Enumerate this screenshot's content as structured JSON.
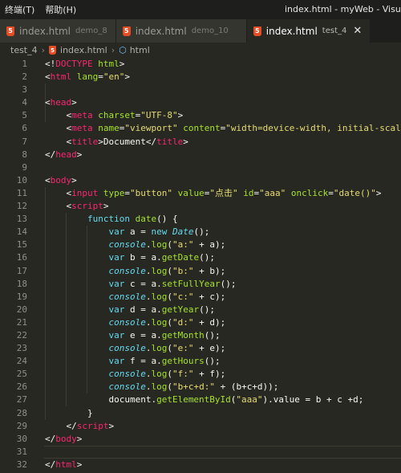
{
  "menubar": {
    "items": [
      {
        "label": "终端(T)"
      },
      {
        "label": "帮助(H)"
      }
    ],
    "window_title": "index.html - myWeb - Visual S"
  },
  "tabs": [
    {
      "icon": "html5-icon",
      "icon_glyph": "5",
      "name": "index.html",
      "dir": "demo_8",
      "active": false
    },
    {
      "icon": "html5-icon",
      "icon_glyph": "5",
      "name": "index.html",
      "dir": "demo_10",
      "active": false
    },
    {
      "icon": "html5-icon",
      "icon_glyph": "5",
      "name": "index.html",
      "dir": "test_4",
      "active": true,
      "close": "✕"
    }
  ],
  "breadcrumb": {
    "folder": "test_4",
    "sep": "›",
    "file": "index.html",
    "element": "html",
    "file_icon_glyph": "5",
    "element_icon_glyph": "⬡"
  },
  "colors": {
    "tag": "#f92672",
    "attr": "#a6e22e",
    "string": "#e6db74",
    "keyword": "#66d9ef",
    "text": "#f8f8f2",
    "func": "#a6e22e",
    "background": "#272822",
    "line_number": "#90908a"
  },
  "editor": {
    "current_line": 31,
    "lines": [
      {
        "n": "1",
        "tokens": [
          [
            "p",
            "<!"
          ],
          [
            "t",
            "DOCTYPE"
          ],
          [
            "p",
            " "
          ],
          [
            "a",
            "html"
          ],
          [
            "p",
            ">"
          ]
        ]
      },
      {
        "n": "2",
        "tokens": [
          [
            "p",
            "<"
          ],
          [
            "t",
            "html"
          ],
          [
            "p",
            " "
          ],
          [
            "a",
            "lang"
          ],
          [
            "p",
            "="
          ],
          [
            "s",
            "\"en\""
          ],
          [
            "p",
            ">"
          ]
        ]
      },
      {
        "n": "3",
        "tokens": []
      },
      {
        "n": "4",
        "tokens": [
          [
            "p",
            "<"
          ],
          [
            "t",
            "head"
          ],
          [
            "p",
            ">"
          ]
        ]
      },
      {
        "n": "5",
        "tokens": [
          [
            "p",
            "    <"
          ],
          [
            "t",
            "meta"
          ],
          [
            "p",
            " "
          ],
          [
            "a",
            "charset"
          ],
          [
            "p",
            "="
          ],
          [
            "s",
            "\"UTF-8\""
          ],
          [
            "p",
            ">"
          ]
        ]
      },
      {
        "n": "6",
        "tokens": [
          [
            "p",
            "    <"
          ],
          [
            "t",
            "meta"
          ],
          [
            "p",
            " "
          ],
          [
            "a",
            "name"
          ],
          [
            "p",
            "="
          ],
          [
            "s",
            "\"viewport\""
          ],
          [
            "p",
            " "
          ],
          [
            "a",
            "content"
          ],
          [
            "p",
            "="
          ],
          [
            "s",
            "\"width=device-width, initial-scale="
          ]
        ]
      },
      {
        "n": "7",
        "tokens": [
          [
            "p",
            "    <"
          ],
          [
            "t",
            "title"
          ],
          [
            "p",
            ">Document</"
          ],
          [
            "t",
            "title"
          ],
          [
            "p",
            ">"
          ]
        ]
      },
      {
        "n": "8",
        "tokens": [
          [
            "p",
            "</"
          ],
          [
            "t",
            "head"
          ],
          [
            "p",
            ">"
          ]
        ]
      },
      {
        "n": "9",
        "tokens": []
      },
      {
        "n": "10",
        "tokens": [
          [
            "p",
            "<"
          ],
          [
            "t",
            "body"
          ],
          [
            "p",
            ">"
          ]
        ]
      },
      {
        "n": "11",
        "tokens": [
          [
            "p",
            "    <"
          ],
          [
            "t",
            "input"
          ],
          [
            "p",
            " "
          ],
          [
            "a",
            "type"
          ],
          [
            "p",
            "="
          ],
          [
            "s",
            "\"button\""
          ],
          [
            "p",
            " "
          ],
          [
            "a",
            "value"
          ],
          [
            "p",
            "="
          ],
          [
            "s",
            "\"点击\""
          ],
          [
            "p",
            " "
          ],
          [
            "a",
            "id"
          ],
          [
            "p",
            "="
          ],
          [
            "s",
            "\"aaa\""
          ],
          [
            "p",
            " "
          ],
          [
            "a",
            "onclick"
          ],
          [
            "p",
            "="
          ],
          [
            "s",
            "\"date()\""
          ],
          [
            "p",
            ">"
          ]
        ]
      },
      {
        "n": "12",
        "tokens": [
          [
            "p",
            "    <"
          ],
          [
            "t",
            "script"
          ],
          [
            "p",
            ">"
          ]
        ]
      },
      {
        "n": "13",
        "tokens": [
          [
            "p",
            "        "
          ],
          [
            "k",
            "function"
          ],
          [
            "p",
            " "
          ],
          [
            "f",
            "date"
          ],
          [
            "p",
            "() {"
          ]
        ]
      },
      {
        "n": "14",
        "tokens": [
          [
            "p",
            "            "
          ],
          [
            "k",
            "var"
          ],
          [
            "p",
            " a = "
          ],
          [
            "k",
            "new"
          ],
          [
            "p",
            " "
          ],
          [
            "c",
            "Date"
          ],
          [
            "p",
            "();"
          ]
        ]
      },
      {
        "n": "15",
        "tokens": [
          [
            "p",
            "            "
          ],
          [
            "c",
            "console"
          ],
          [
            "p",
            "."
          ],
          [
            "f",
            "log"
          ],
          [
            "p",
            "("
          ],
          [
            "s",
            "\"a:\""
          ],
          [
            "p",
            " + a);"
          ]
        ]
      },
      {
        "n": "16",
        "tokens": [
          [
            "p",
            "            "
          ],
          [
            "k",
            "var"
          ],
          [
            "p",
            " b = a."
          ],
          [
            "f",
            "getDate"
          ],
          [
            "p",
            "();"
          ]
        ]
      },
      {
        "n": "17",
        "tokens": [
          [
            "p",
            "            "
          ],
          [
            "c",
            "console"
          ],
          [
            "p",
            "."
          ],
          [
            "f",
            "log"
          ],
          [
            "p",
            "("
          ],
          [
            "s",
            "\"b:\""
          ],
          [
            "p",
            " + b);"
          ]
        ]
      },
      {
        "n": "18",
        "tokens": [
          [
            "p",
            "            "
          ],
          [
            "k",
            "var"
          ],
          [
            "p",
            " c = a."
          ],
          [
            "f",
            "setFullYear"
          ],
          [
            "p",
            "();"
          ]
        ]
      },
      {
        "n": "19",
        "tokens": [
          [
            "p",
            "            "
          ],
          [
            "c",
            "console"
          ],
          [
            "p",
            "."
          ],
          [
            "f",
            "log"
          ],
          [
            "p",
            "("
          ],
          [
            "s",
            "\"c:\""
          ],
          [
            "p",
            " + c);"
          ]
        ]
      },
      {
        "n": "20",
        "tokens": [
          [
            "p",
            "            "
          ],
          [
            "k",
            "var"
          ],
          [
            "p",
            " d = a."
          ],
          [
            "f",
            "getYear"
          ],
          [
            "p",
            "();"
          ]
        ]
      },
      {
        "n": "21",
        "tokens": [
          [
            "p",
            "            "
          ],
          [
            "c",
            "console"
          ],
          [
            "p",
            "."
          ],
          [
            "f",
            "log"
          ],
          [
            "p",
            "("
          ],
          [
            "s",
            "\"d:\""
          ],
          [
            "p",
            " + d);"
          ]
        ]
      },
      {
        "n": "22",
        "tokens": [
          [
            "p",
            "            "
          ],
          [
            "k",
            "var"
          ],
          [
            "p",
            " e = a."
          ],
          [
            "f",
            "getMonth"
          ],
          [
            "p",
            "();"
          ]
        ]
      },
      {
        "n": "23",
        "tokens": [
          [
            "p",
            "            "
          ],
          [
            "c",
            "console"
          ],
          [
            "p",
            "."
          ],
          [
            "f",
            "log"
          ],
          [
            "p",
            "("
          ],
          [
            "s",
            "\"e:\""
          ],
          [
            "p",
            " + e);"
          ]
        ]
      },
      {
        "n": "24",
        "tokens": [
          [
            "p",
            "            "
          ],
          [
            "k",
            "var"
          ],
          [
            "p",
            " f = a."
          ],
          [
            "f",
            "getHours"
          ],
          [
            "p",
            "();"
          ]
        ]
      },
      {
        "n": "25",
        "tokens": [
          [
            "p",
            "            "
          ],
          [
            "c",
            "console"
          ],
          [
            "p",
            "."
          ],
          [
            "f",
            "log"
          ],
          [
            "p",
            "("
          ],
          [
            "s",
            "\"f:\""
          ],
          [
            "p",
            " + f);"
          ]
        ]
      },
      {
        "n": "26",
        "tokens": [
          [
            "p",
            "            "
          ],
          [
            "c",
            "console"
          ],
          [
            "p",
            "."
          ],
          [
            "f",
            "log"
          ],
          [
            "p",
            "("
          ],
          [
            "s",
            "\"b+c+d:\""
          ],
          [
            "p",
            " + (b+c+d));"
          ]
        ]
      },
      {
        "n": "27",
        "tokens": [
          [
            "p",
            "            document."
          ],
          [
            "f",
            "getElementById"
          ],
          [
            "p",
            "("
          ],
          [
            "s",
            "\"aaa\""
          ],
          [
            "p",
            ").value = b + c +d;"
          ]
        ]
      },
      {
        "n": "28",
        "tokens": [
          [
            "p",
            "        }"
          ]
        ]
      },
      {
        "n": "29",
        "tokens": [
          [
            "p",
            "    </"
          ],
          [
            "t",
            "script"
          ],
          [
            "p",
            ">"
          ]
        ]
      },
      {
        "n": "30",
        "tokens": [
          [
            "p",
            "</"
          ],
          [
            "t",
            "body"
          ],
          [
            "p",
            ">"
          ]
        ]
      },
      {
        "n": "31",
        "tokens": []
      },
      {
        "n": "32",
        "tokens": [
          [
            "p",
            "</"
          ],
          [
            "t",
            "html"
          ],
          [
            "p",
            ">"
          ]
        ]
      }
    ]
  }
}
